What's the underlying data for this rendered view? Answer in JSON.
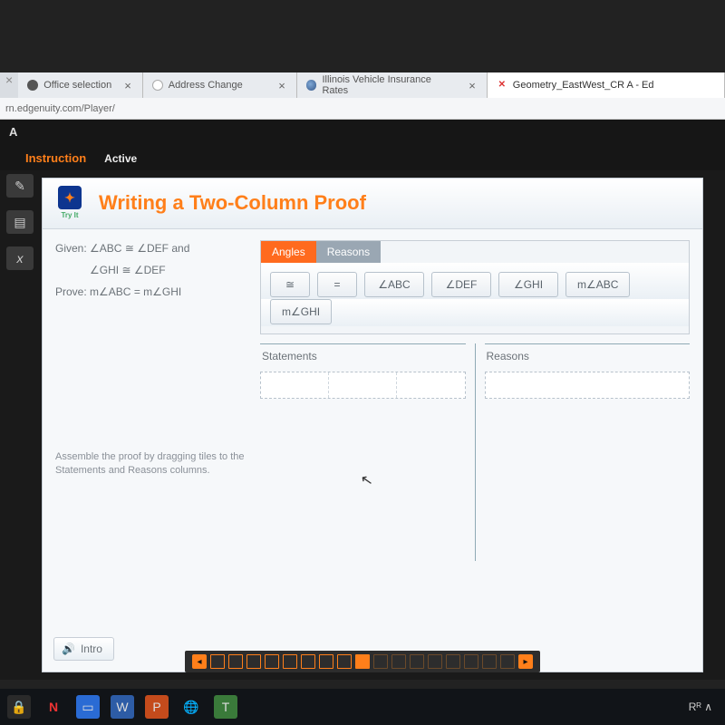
{
  "browser": {
    "tabs": [
      {
        "label": "Office selection"
      },
      {
        "label": "Address Change"
      },
      {
        "label": "Illinois Vehicle Insurance Rates"
      },
      {
        "label": "Geometry_EastWest_CR A - Ed"
      }
    ],
    "url": "rn.edgenuity.com/Player/"
  },
  "appbar": {
    "letter": "A",
    "instruction": "Instruction",
    "active": "Active"
  },
  "card": {
    "tryit": "Try It",
    "title": "Writing a Two-Column Proof",
    "given_label": "Given:",
    "given_line1_a": "ABC",
    "given_line1_b": "DEF",
    "given_and": "and",
    "given_line2_a": "GHI",
    "given_line2_b": "DEF",
    "prove_label": "Prove:",
    "prove_a": "m∠ABC",
    "prove_eq": "=",
    "prove_b": "m∠GHI",
    "assemble": "Assemble the proof by dragging tiles to the Statements and Reasons columns.",
    "tabs": {
      "angles": "Angles",
      "reasons": "Reasons"
    },
    "tiles": {
      "cong": "≅",
      "eq": "=",
      "abc": "∠ABC",
      "def": "∠DEF",
      "ghi": "∠GHI",
      "mabc": "m∠ABC",
      "mghi": "m∠GHI"
    },
    "headers": {
      "statements": "Statements",
      "reasons": "Reasons"
    },
    "intro": "Intro"
  },
  "taskbar": {
    "right": "Rᴿ   ∧"
  }
}
